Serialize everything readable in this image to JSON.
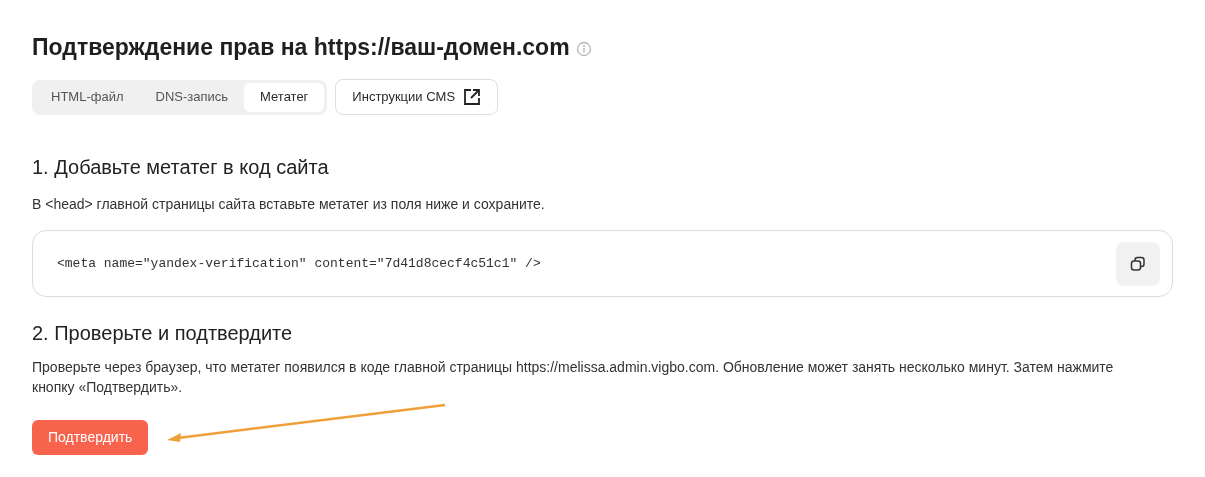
{
  "title": "Подтверждение прав на https://ваш-домен.com",
  "tabs": [
    {
      "label": "HTML-файл",
      "selected": false
    },
    {
      "label": "DNS-запись",
      "selected": false
    },
    {
      "label": "Метатег",
      "selected": true
    }
  ],
  "cms_button": "Инструкции CMS",
  "step1": {
    "heading": "1. Добавьте метатег в код сайта",
    "text": "В <head> главной страницы сайта вставьте метатег из поля ниже и сохраните.",
    "code": "<meta name=\"yandex-verification\" content=\"7d41d8cecf4c51c1\" />"
  },
  "step2": {
    "heading": "2. Проверьте и подтвердите",
    "text": "Проверьте через браузер, что метатег появился в коде главной страницы https://melissa.admin.vigbo.com. Обновление может занять несколько минут. Затем нажмите кнопку «Подтвердить»."
  },
  "confirm_button": "Подтвердить"
}
